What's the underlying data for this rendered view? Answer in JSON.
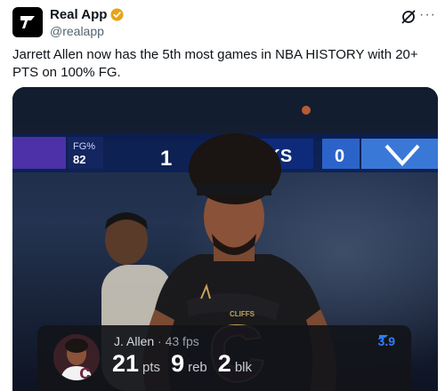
{
  "tweet": {
    "display_name": "Real App",
    "handle": "@realapp",
    "text": "Jarrett Allen now has the 5th most games in NBA HISTORY with 20+ PTS on 100% FG.",
    "more_icon": "···"
  },
  "media": {
    "scoreboard": {
      "left_top": "FG%",
      "left_bottom": "82",
      "quarter_score": "1",
      "team_abbr": "CKS",
      "team_score": "0"
    },
    "jersey_text": "CLIFFS",
    "stat_card": {
      "player": "J. Allen",
      "separator": "·",
      "fps": "43 fps",
      "rating": "3.9",
      "pts_value": "21",
      "pts_label": "pts",
      "reb_value": "9",
      "reb_label": "reb",
      "blk_value": "2",
      "blk_label": "blk"
    }
  },
  "colors": {
    "verified_badge": "#e8a317",
    "rating_blue": "#2f7cff",
    "cavs_wine": "#6f263d",
    "cavs_gold": "#c8a25a"
  }
}
